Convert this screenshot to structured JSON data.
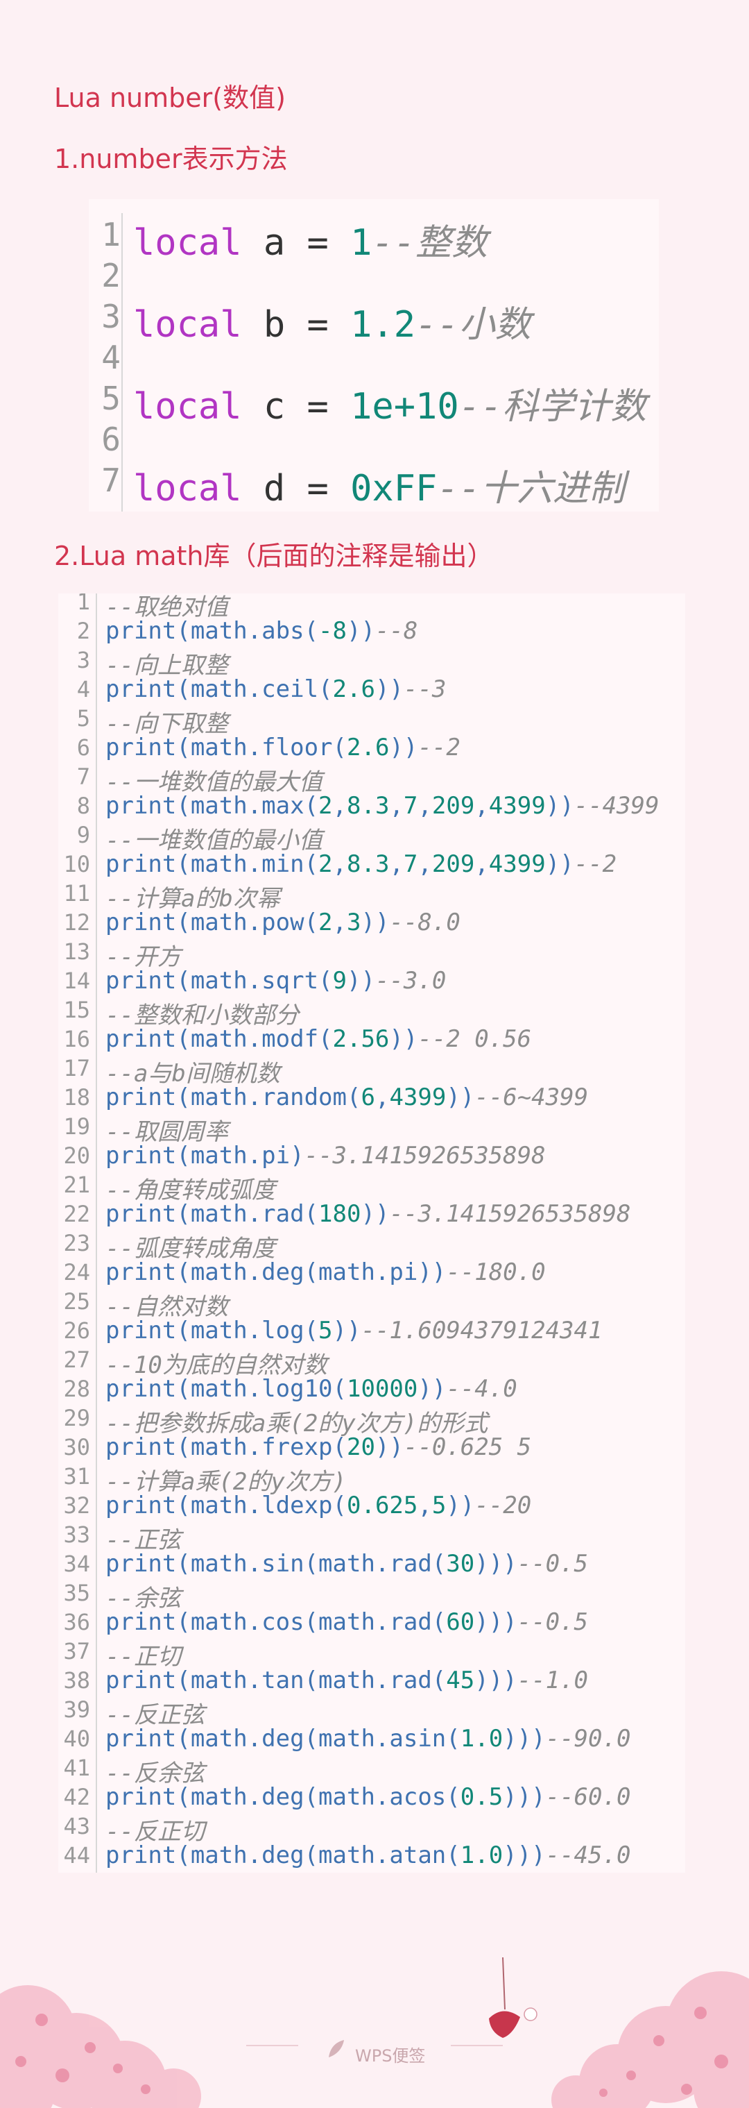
{
  "headings": {
    "title": "Lua number(数值)",
    "section1": "1.number表示方法",
    "section2": "2.Lua math库（后面的注释是输出）"
  },
  "snippet1": [
    {
      "n": "1",
      "t": [
        [
          "kw",
          "local"
        ],
        [
          "id",
          " a "
        ],
        [
          "op",
          "= "
        ],
        [
          "num",
          "1"
        ],
        [
          "cm",
          "--整数"
        ]
      ]
    },
    {
      "n": "2",
      "t": []
    },
    {
      "n": "3",
      "t": [
        [
          "kw",
          "local"
        ],
        [
          "id",
          " b "
        ],
        [
          "op",
          "= "
        ],
        [
          "num",
          "1.2"
        ],
        [
          "cm",
          "--小数"
        ]
      ]
    },
    {
      "n": "4",
      "t": []
    },
    {
      "n": "5",
      "t": [
        [
          "kw",
          "local"
        ],
        [
          "id",
          " c "
        ],
        [
          "op",
          "= "
        ],
        [
          "num",
          "1e+10"
        ],
        [
          "cm",
          "--科学计数"
        ]
      ]
    },
    {
      "n": "6",
      "t": []
    },
    {
      "n": "7",
      "t": [
        [
          "kw",
          "local"
        ],
        [
          "id",
          " d "
        ],
        [
          "op",
          "= "
        ],
        [
          "num",
          "0xFF"
        ],
        [
          "cm",
          "--十六进制"
        ]
      ]
    }
  ],
  "snippet2": [
    {
      "n": "1",
      "t": [
        [
          "cm",
          "--取绝对值"
        ]
      ]
    },
    {
      "n": "2",
      "t": [
        [
          "fn",
          "print(math.abs("
        ],
        [
          "num",
          "-8"
        ],
        [
          "fn",
          "))"
        ],
        [
          "cm",
          "--8"
        ]
      ]
    },
    {
      "n": "3",
      "t": [
        [
          "cm",
          "--向上取整"
        ]
      ]
    },
    {
      "n": "4",
      "t": [
        [
          "fn",
          "print(math.ceil("
        ],
        [
          "num",
          "2.6"
        ],
        [
          "fn",
          "))"
        ],
        [
          "cm",
          "--3"
        ]
      ]
    },
    {
      "n": "5",
      "t": [
        [
          "cm",
          "--向下取整"
        ]
      ]
    },
    {
      "n": "6",
      "t": [
        [
          "fn",
          "print(math.floor("
        ],
        [
          "num",
          "2.6"
        ],
        [
          "fn",
          "))"
        ],
        [
          "cm",
          "--2"
        ]
      ]
    },
    {
      "n": "7",
      "t": [
        [
          "cm",
          "--一堆数值的最大值"
        ]
      ]
    },
    {
      "n": "8",
      "t": [
        [
          "fn",
          "print(math.max("
        ],
        [
          "num",
          "2"
        ],
        [
          "fn",
          ","
        ],
        [
          "num",
          "8.3"
        ],
        [
          "fn",
          ","
        ],
        [
          "num",
          "7"
        ],
        [
          "fn",
          ","
        ],
        [
          "num",
          "209"
        ],
        [
          "fn",
          ","
        ],
        [
          "num",
          "4399"
        ],
        [
          "fn",
          "))"
        ],
        [
          "cm",
          "--4399"
        ]
      ]
    },
    {
      "n": "9",
      "t": [
        [
          "cm",
          "--一堆数值的最小值"
        ]
      ]
    },
    {
      "n": "10",
      "t": [
        [
          "fn",
          "print(math.min("
        ],
        [
          "num",
          "2"
        ],
        [
          "fn",
          ","
        ],
        [
          "num",
          "8.3"
        ],
        [
          "fn",
          ","
        ],
        [
          "num",
          "7"
        ],
        [
          "fn",
          ","
        ],
        [
          "num",
          "209"
        ],
        [
          "fn",
          ","
        ],
        [
          "num",
          "4399"
        ],
        [
          "fn",
          "))"
        ],
        [
          "cm",
          "--2"
        ]
      ]
    },
    {
      "n": "11",
      "t": [
        [
          "cm",
          "--计算a的b次幂"
        ]
      ]
    },
    {
      "n": "12",
      "t": [
        [
          "fn",
          "print(math.pow("
        ],
        [
          "num",
          "2"
        ],
        [
          "fn",
          ","
        ],
        [
          "num",
          "3"
        ],
        [
          "fn",
          "))"
        ],
        [
          "cm",
          "--8.0"
        ]
      ]
    },
    {
      "n": "13",
      "t": [
        [
          "cm",
          "--开方"
        ]
      ]
    },
    {
      "n": "14",
      "t": [
        [
          "fn",
          "print(math.sqrt("
        ],
        [
          "num",
          "9"
        ],
        [
          "fn",
          "))"
        ],
        [
          "cm",
          "--3.0"
        ]
      ]
    },
    {
      "n": "15",
      "t": [
        [
          "cm",
          "--整数和小数部分"
        ]
      ]
    },
    {
      "n": "16",
      "t": [
        [
          "fn",
          "print(math.modf("
        ],
        [
          "num",
          "2.56"
        ],
        [
          "fn",
          "))"
        ],
        [
          "cm",
          "--2 0.56"
        ]
      ]
    },
    {
      "n": "17",
      "t": [
        [
          "cm",
          "--a与b间随机数"
        ]
      ]
    },
    {
      "n": "18",
      "t": [
        [
          "fn",
          "print(math.random("
        ],
        [
          "num",
          "6"
        ],
        [
          "fn",
          ","
        ],
        [
          "num",
          "4399"
        ],
        [
          "fn",
          "))"
        ],
        [
          "cm",
          "--6~4399"
        ]
      ]
    },
    {
      "n": "19",
      "t": [
        [
          "cm",
          "--取圆周率"
        ]
      ]
    },
    {
      "n": "20",
      "t": [
        [
          "fn",
          "print(math.pi)"
        ],
        [
          "cm",
          "--3.1415926535898"
        ]
      ]
    },
    {
      "n": "21",
      "t": [
        [
          "cm",
          "--角度转成弧度"
        ]
      ]
    },
    {
      "n": "22",
      "t": [
        [
          "fn",
          "print(math.rad("
        ],
        [
          "num",
          "180"
        ],
        [
          "fn",
          "))"
        ],
        [
          "cm",
          "--3.1415926535898"
        ]
      ]
    },
    {
      "n": "23",
      "t": [
        [
          "cm",
          "--弧度转成角度"
        ]
      ]
    },
    {
      "n": "24",
      "t": [
        [
          "fn",
          "print(math.deg(math.pi))"
        ],
        [
          "cm",
          "--180.0"
        ]
      ]
    },
    {
      "n": "25",
      "t": [
        [
          "cm",
          "--自然对数"
        ]
      ]
    },
    {
      "n": "26",
      "t": [
        [
          "fn",
          "print(math.log("
        ],
        [
          "num",
          "5"
        ],
        [
          "fn",
          "))"
        ],
        [
          "cm",
          "--1.6094379124341"
        ]
      ]
    },
    {
      "n": "27",
      "t": [
        [
          "cm",
          "--10为底的自然对数"
        ]
      ]
    },
    {
      "n": "28",
      "t": [
        [
          "fn",
          "print(math.log10("
        ],
        [
          "num",
          "10000"
        ],
        [
          "fn",
          "))"
        ],
        [
          "cm",
          "--4.0"
        ]
      ]
    },
    {
      "n": "29",
      "t": [
        [
          "cm",
          "--把参数拆成a乘(2的y次方)的形式"
        ]
      ]
    },
    {
      "n": "30",
      "t": [
        [
          "fn",
          "print(math.frexp("
        ],
        [
          "num",
          "20"
        ],
        [
          "fn",
          "))"
        ],
        [
          "cm",
          "--0.625 5"
        ]
      ]
    },
    {
      "n": "31",
      "t": [
        [
          "cm",
          "--计算a乘(2的y次方)"
        ]
      ]
    },
    {
      "n": "32",
      "t": [
        [
          "fn",
          "print(math.ldexp("
        ],
        [
          "num",
          "0.625"
        ],
        [
          "fn",
          ","
        ],
        [
          "num",
          "5"
        ],
        [
          "fn",
          "))"
        ],
        [
          "cm",
          "--20"
        ]
      ]
    },
    {
      "n": "33",
      "t": [
        [
          "cm",
          "--正弦"
        ]
      ]
    },
    {
      "n": "34",
      "t": [
        [
          "fn",
          "print(math.sin(math.rad("
        ],
        [
          "num",
          "30"
        ],
        [
          "fn",
          ")))"
        ],
        [
          "cm",
          "--0.5"
        ]
      ]
    },
    {
      "n": "35",
      "t": [
        [
          "cm",
          "--余弦"
        ]
      ]
    },
    {
      "n": "36",
      "t": [
        [
          "fn",
          "print(math.cos(math.rad("
        ],
        [
          "num",
          "60"
        ],
        [
          "fn",
          ")))"
        ],
        [
          "cm",
          "--0.5"
        ]
      ]
    },
    {
      "n": "37",
      "t": [
        [
          "cm",
          "--正切"
        ]
      ]
    },
    {
      "n": "38",
      "t": [
        [
          "fn",
          "print(math.tan(math.rad("
        ],
        [
          "num",
          "45"
        ],
        [
          "fn",
          ")))"
        ],
        [
          "cm",
          "--1.0"
        ]
      ]
    },
    {
      "n": "39",
      "t": [
        [
          "cm",
          "--反正弦"
        ]
      ]
    },
    {
      "n": "40",
      "t": [
        [
          "fn",
          "print(math.deg(math.asin("
        ],
        [
          "num",
          "1.0"
        ],
        [
          "fn",
          ")))"
        ],
        [
          "cm",
          "--90.0"
        ]
      ]
    },
    {
      "n": "41",
      "t": [
        [
          "cm",
          "--反余弦"
        ]
      ]
    },
    {
      "n": "42",
      "t": [
        [
          "fn",
          "print(math.deg(math.acos("
        ],
        [
          "num",
          "0.5"
        ],
        [
          "fn",
          ")))"
        ],
        [
          "cm",
          "--60.0"
        ]
      ]
    },
    {
      "n": "43",
      "t": [
        [
          "cm",
          "--反正切"
        ]
      ]
    },
    {
      "n": "44",
      "t": [
        [
          "fn",
          "print(math.deg(math.atan("
        ],
        [
          "num",
          "1.0"
        ],
        [
          "fn",
          ")))"
        ],
        [
          "cm",
          "--45.0"
        ]
      ]
    }
  ],
  "footer": {
    "brand": "WPS便签"
  },
  "colors": {
    "heading": "#d2354f",
    "background": "#fdf1f4",
    "keyword": "#b135c3",
    "function": "#3f72b0",
    "number": "#118777",
    "comment": "#8c8c8c"
  }
}
